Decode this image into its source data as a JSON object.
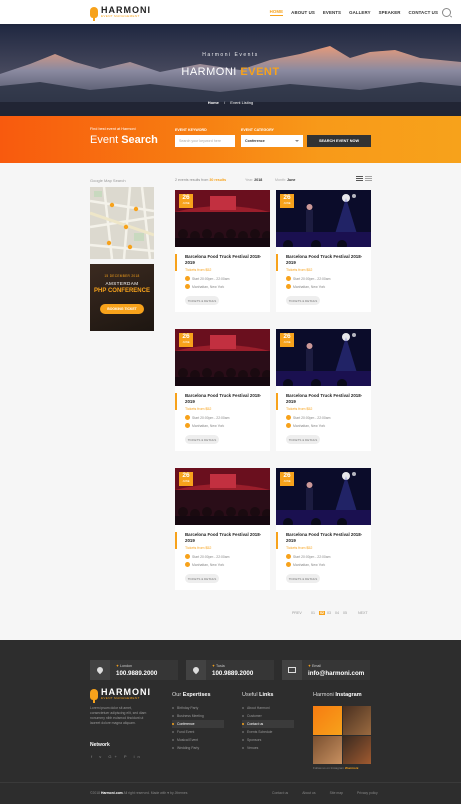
{
  "brand": {
    "name": "HARMONI",
    "tagline": "EVENT MANAGEMENT"
  },
  "nav": {
    "items": [
      "HOME",
      "ABOUT US",
      "EVENTS",
      "GALLERY",
      "SPEAKER",
      "CONTACT US"
    ],
    "active": "HOME"
  },
  "hero": {
    "subtitle": "Harmoni Events",
    "title_a": "HARMONI",
    "title_b": "EVENT",
    "crumb_home": "Home",
    "crumb_sep": "/",
    "crumb_current": "Event Listing"
  },
  "search": {
    "small": "Find best event at Harmoni",
    "title_a": "Event",
    "title_b": "Search",
    "keyword_label": "EVENT KEYWORD",
    "keyword_placeholder": "Search your keyword here",
    "category_label": "EVENT CATEGORY",
    "category_value": "Conference",
    "button": "SEARCH EVENT NOW"
  },
  "sidebar": {
    "map_title": "Google Map Search",
    "promo": {
      "date": "15 DECEMBER 2018",
      "city": "AMSTERDAM",
      "title": "PHP CONFERENCE",
      "button": "BOOKING TICKET"
    }
  },
  "toolbar": {
    "count_prefix": "2 events results from",
    "count": "30 results",
    "year_label": "Year:",
    "year": "2018",
    "month_label": "Month:",
    "month": "June"
  },
  "events": [
    {
      "day": "26",
      "month": "JUNE",
      "title": "Barcelona Food Truck Festival 2018-2019",
      "price": "Tickets from $52",
      "time": "Start 20:00pm - 22:00am",
      "place": "Manhattan, New York",
      "button": "TICKETS & DETAILS"
    },
    {
      "day": "26",
      "month": "JUNE",
      "title": "Barcelona Food Truck Festival 2018-2019",
      "price": "Tickets from $52",
      "time": "Start 20:00pm - 22:00am",
      "place": "Manhattan, New York",
      "button": "TICKETS & DETAILS"
    },
    {
      "day": "26",
      "month": "JUNE",
      "title": "Barcelona Food Truck Festival 2018-2019",
      "price": "Tickets from $52",
      "time": "Start 20:00pm - 22:00am",
      "place": "Manhattan, New York",
      "button": "TICKETS & DETAILS"
    },
    {
      "day": "26",
      "month": "JUNE",
      "title": "Barcelona Food Truck Festival 2018-2019",
      "price": "Tickets from $52",
      "time": "Start 20:00pm - 22:00am",
      "place": "Manhattan, New York",
      "button": "TICKETS & DETAILS"
    },
    {
      "day": "26",
      "month": "JUNE",
      "title": "Barcelona Food Truck Festival 2018-2019",
      "price": "Tickets from $52",
      "time": "Start 20:00pm - 22:00am",
      "place": "Manhattan, New York",
      "button": "TICKETS & DETAILS"
    },
    {
      "day": "26",
      "month": "JUNE",
      "title": "Barcelona Food Truck Festival 2018-2019",
      "price": "Tickets from $52",
      "time": "Start 20:00pm - 22:00am",
      "place": "Manhattan, New York",
      "button": "TICKETS & DETAILS"
    }
  ],
  "pagination": {
    "prev": "PREV",
    "pages": [
      "01",
      "02",
      "03",
      "04",
      "05"
    ],
    "current": "02",
    "next": "NEXT"
  },
  "footer": {
    "contacts": [
      {
        "city": "London",
        "value": "100.9889.2000"
      },
      {
        "city": "Tusla",
        "value": "100.9889.2000"
      },
      {
        "city": "Email",
        "value": "info@harmoni.com"
      }
    ],
    "desc": "Lorem ipsum dolor sit amet, consectetuer adipiscing elit, sed diam nonummy nibh euismod tincidunt ut laoreet dolore magna aliquam.",
    "network": "Network",
    "social": "f  v  G+  P  in",
    "expertise": {
      "a": "Our",
      "b": "Expertises",
      "items": [
        "Birthday Party",
        "Business Meeting",
        "Conference",
        "Fund Event",
        "Musical Event",
        "Wedding Party"
      ],
      "active": "Conference"
    },
    "links": {
      "a": "Useful",
      "b": "Links",
      "items": [
        "About Harmoni",
        "Customer",
        "Contact us",
        "Events Schedule",
        "Sponsors",
        "Venues"
      ],
      "active": "Contact us"
    },
    "insta": {
      "a": "Harmoni",
      "b": "Instagram",
      "follow": "Follow us on Instagram",
      "handle": "#harmoni"
    },
    "copyright_a": "©2018",
    "copyright_b": "Harmoni.com",
    "copyright_c": "All right reserved. Made with ♥ by Jthemes",
    "bottom_links": [
      "Contact us",
      "About us",
      "Site map",
      "Privacy policy"
    ]
  }
}
